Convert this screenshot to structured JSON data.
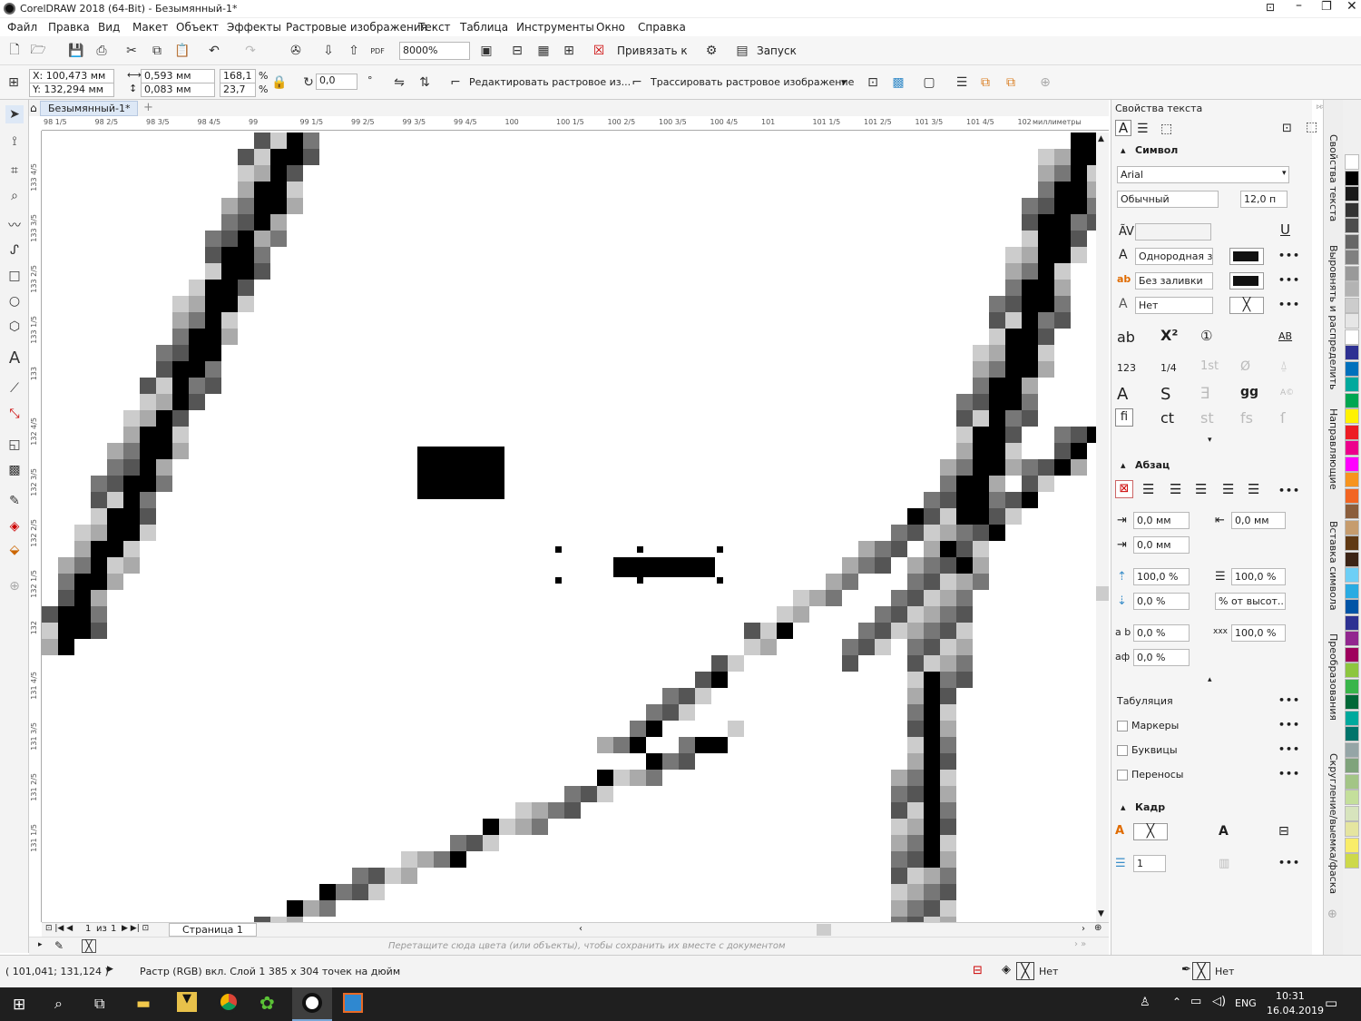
{
  "window": {
    "title": "CorelDRAW 2018 (64-Bit) - Безымянный-1*"
  },
  "menu": [
    "Файл",
    "Правка",
    "Вид",
    "Макет",
    "Объект",
    "Эффекты",
    "Растровые изображения",
    "Текст",
    "Таблица",
    "Инструменты",
    "Окно",
    "Справка"
  ],
  "toolbar": {
    "zoom": "8000%",
    "snap_label": "Привязать к",
    "launch_label": "Запуск"
  },
  "propbar": {
    "x": "X: 100,473 мм",
    "y": "Y: 132,294 мм",
    "w": "0,593 мм",
    "h": "0,083 мм",
    "sx": "168,1",
    "sy": "23,7",
    "pct": "%",
    "angle": "0,0",
    "edit_bitmap": "Редактировать растровое из...",
    "trace_bitmap": "Трассировать растровое изображение"
  },
  "document": {
    "tab": "Безымянный-1*",
    "ruler_unit": "миллиметры",
    "ruler_ticks": [
      "98 1/5",
      "98 2/5",
      "98 3/5",
      "98 4/5",
      "99",
      "99 1/5",
      "99 2/5",
      "99 3/5",
      "99 4/5",
      "100",
      "100 1/5",
      "100 2/5",
      "100 3/5",
      "100 4/5",
      "101",
      "101 1/5",
      "101 2/5",
      "101 3/5",
      "101 4/5",
      "102"
    ],
    "vruler_ticks": [
      "133 4/5",
      "133 3/5",
      "133 2/5",
      "133 1/5",
      "133",
      "132 4/5",
      "132 3/5",
      "132 2/5",
      "132 1/5",
      "132",
      "131 4/5",
      "131 3/5",
      "131 2/5",
      "131 1/5"
    ]
  },
  "pagenav": {
    "current": "1",
    "of": "из",
    "total": "1",
    "page_tab": "Страница 1"
  },
  "docpalette": {
    "hint": "Перетащите сюда цвета (или объекты), чтобы сохранить их вместе с документом"
  },
  "status": {
    "coords": "( 101,041; 131,124 )",
    "info": "Растр (RGB) вкл. Слой 1 385 x 304 точек на дюйм",
    "fill_label": "Нет",
    "outline_label": "Нет"
  },
  "panel": {
    "title": "Свойства текста",
    "symbol": {
      "heading": "Символ",
      "font": "Arial",
      "style": "Обычный",
      "size": "12,0 п",
      "fill_type": "Однородная з...",
      "bg_fill": "Без заливки",
      "outline": "Нет"
    },
    "paragraph": {
      "heading": "Абзац",
      "indent_left": "0,0 мм",
      "indent_right": "0,0 мм",
      "indent_first": "0,0 мм",
      "line_spacing": "100,0 %",
      "before": "0,0 %",
      "after_unit": "% от высот...",
      "char_spacing": "0,0 %",
      "word_spacing": "100,0 %",
      "lang_spacing": "0,0 %"
    },
    "tabs_label": "Табуляция",
    "markers": "Маркеры",
    "dropcaps": "Буквицы",
    "hyphens": "Переносы",
    "frame": {
      "heading": "Кадр",
      "columns": "1"
    }
  },
  "dockers": [
    "Свойства текста",
    "Выровнять и распределить",
    "Направляющие",
    "Вставка символа",
    "Преобразования",
    "Скругление/выемка/фаска"
  ],
  "palette_colors": [
    "#ffffff",
    "#000000",
    "#1a1a1a",
    "#333333",
    "#4d4d4d",
    "#666666",
    "#808080",
    "#999999",
    "#b3b3b3",
    "#cccccc",
    "#e6e6e6",
    "#ffffff",
    "#2e3192",
    "#0071bc",
    "#00a99d",
    "#00a651",
    "#fff200",
    "#ed1c24",
    "#ec008c",
    "#ff00ff",
    "#f7941d",
    "#f26522",
    "#8b5e3c",
    "#c69c6d",
    "#603913",
    "#3c2415",
    "#6dcff6",
    "#29abe2",
    "#0054a6",
    "#2e3192",
    "#92278f",
    "#9e005d",
    "#8dc63f",
    "#39b54a",
    "#006837",
    "#00a99d",
    "#00746b",
    "#95a5a6",
    "#7fa37b",
    "#a3c586",
    "#c4df9b",
    "#d7e4bd",
    "#e5e5a0",
    "#f9ed69",
    "#cdd94a"
  ],
  "taskbar": {
    "time": "10:31",
    "date": "16.04.2019",
    "lang": "ENG"
  }
}
